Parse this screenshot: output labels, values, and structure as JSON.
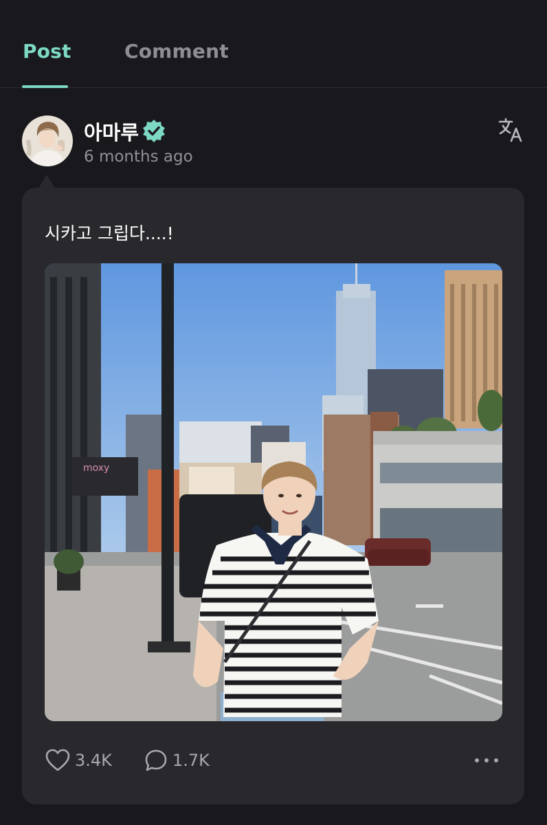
{
  "tabs": {
    "post": "Post",
    "comment": "Comment",
    "active": "Post"
  },
  "colors": {
    "accent": "#7dd8c4",
    "background": "#19191d",
    "card": "#28282d",
    "muted_text": "#909097"
  },
  "post": {
    "author": {
      "name": "아마루",
      "verified_icon": "verified-badge-icon",
      "avatar": "avatar"
    },
    "time": "6 months ago",
    "translate_icon": "translate-icon",
    "text": "시카고 그립다....!",
    "image": "photo",
    "likes": "3.4K",
    "comments": "1.7K",
    "icons": {
      "like": "heart-icon",
      "comment": "comment-icon",
      "more": "more-options-icon"
    }
  }
}
